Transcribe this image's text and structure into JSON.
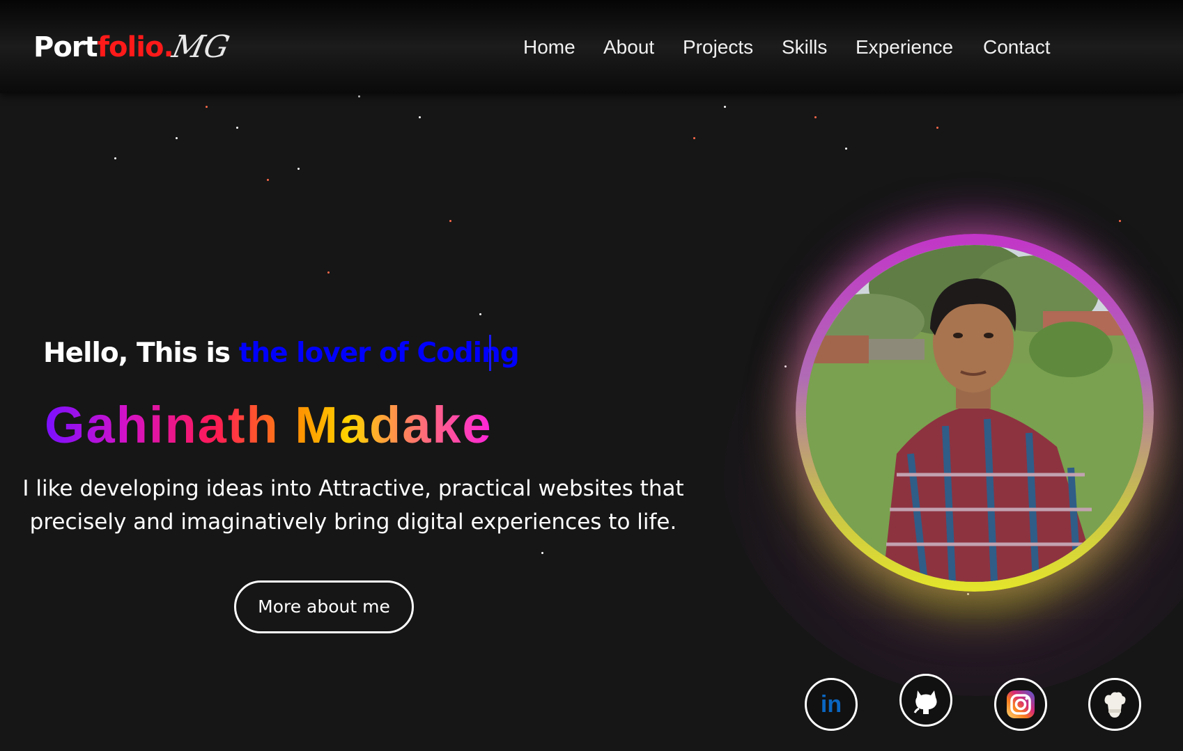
{
  "header": {
    "logo_part1": "Port",
    "logo_part2": "folio.",
    "signature": "MG",
    "nav": [
      {
        "label": "Home"
      },
      {
        "label": "About"
      },
      {
        "label": "Projects"
      },
      {
        "label": "Skills"
      },
      {
        "label": "Experience"
      },
      {
        "label": "Contact"
      }
    ]
  },
  "hero": {
    "greeting_static": "Hello, This is ",
    "greeting_typed": "the lover of Coding",
    "name": "Gahinath Madake",
    "tagline_line1": "I like developing ideas into Attractive, practical websites that",
    "tagline_line2": "precisely and imaginatively bring digital experiences to life.",
    "button_label": "More about me"
  },
  "social": [
    {
      "icon": "linkedin-icon"
    },
    {
      "icon": "github-icon"
    },
    {
      "icon": "instagram-icon"
    },
    {
      "icon": "chef-icon"
    }
  ],
  "colors": {
    "accent_red": "#ff1a1a",
    "typed_blue": "#0000ff",
    "background": "#161616",
    "linkedin_blue": "#0a66c2"
  }
}
